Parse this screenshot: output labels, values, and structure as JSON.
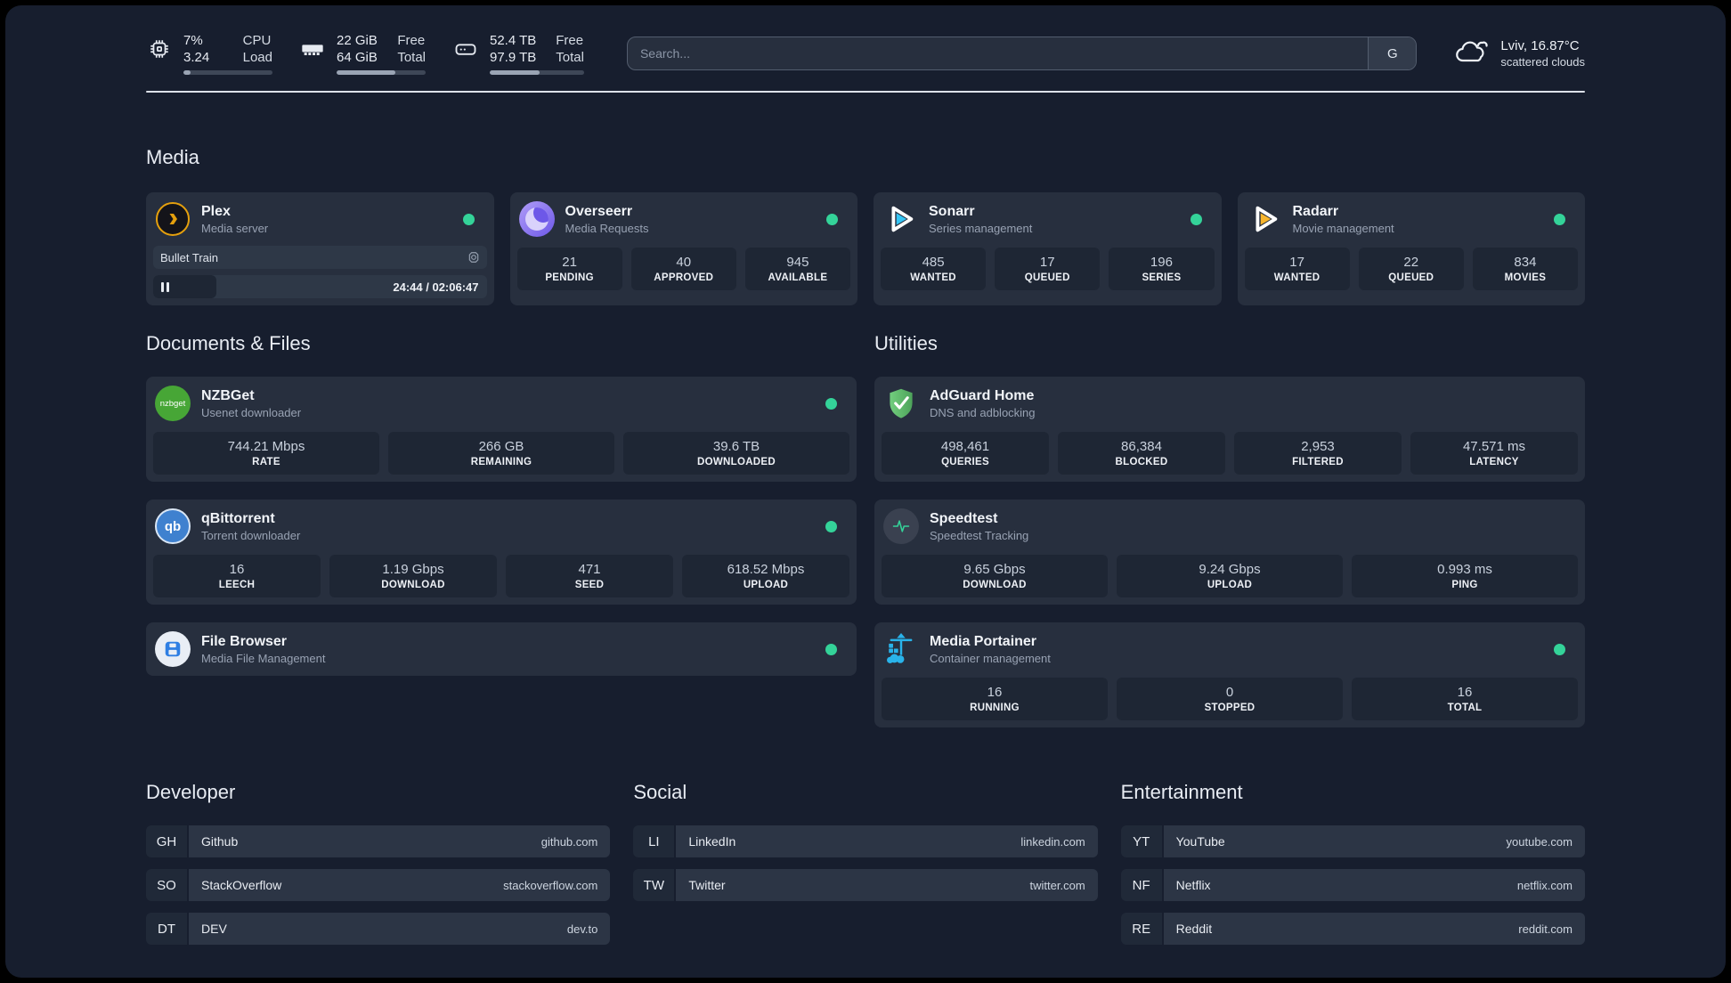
{
  "topbar": {
    "cpu": {
      "value1": "7%",
      "value2": "3.24",
      "label1": "CPU",
      "label2": "Load",
      "progress_pct": 8
    },
    "memory": {
      "value1": "22 GiB",
      "value2": "64 GiB",
      "label1": "Free",
      "label2": "Total",
      "progress_pct": 66
    },
    "disk": {
      "value1": "52.4 TB",
      "value2": "97.9 TB",
      "label1": "Free",
      "label2": "Total",
      "progress_pct": 53
    },
    "search": {
      "placeholder": "Search...",
      "provider_button": "G"
    },
    "weather": {
      "location_temp": "Lviv, 16.87°C",
      "condition": "scattered clouds",
      "icon": "cloud-icon"
    }
  },
  "sections": {
    "media": "Media",
    "documents": "Documents & Files",
    "utilities": "Utilities",
    "developer": "Developer",
    "social": "Social",
    "entertainment": "Entertainment"
  },
  "services": {
    "plex": {
      "name": "Plex",
      "desc": "Media server",
      "icon": "plex-icon",
      "status": "online",
      "now_playing": {
        "title": "Bullet Train",
        "time_display": "24:44 / 02:06:47",
        "progress_pct": 19,
        "state": "paused"
      }
    },
    "overseerr": {
      "name": "Overseerr",
      "desc": "Media Requests",
      "icon": "overseerr-icon",
      "status": "online",
      "stats": [
        {
          "value": "21",
          "label": "PENDING"
        },
        {
          "value": "40",
          "label": "APPROVED"
        },
        {
          "value": "945",
          "label": "AVAILABLE"
        }
      ]
    },
    "sonarr": {
      "name": "Sonarr",
      "desc": "Series management",
      "icon": "sonarr-icon",
      "status": "online",
      "stats": [
        {
          "value": "485",
          "label": "WANTED"
        },
        {
          "value": "17",
          "label": "QUEUED"
        },
        {
          "value": "196",
          "label": "SERIES"
        }
      ]
    },
    "radarr": {
      "name": "Radarr",
      "desc": "Movie management",
      "icon": "radarr-icon",
      "status": "online",
      "stats": [
        {
          "value": "17",
          "label": "WANTED"
        },
        {
          "value": "22",
          "label": "QUEUED"
        },
        {
          "value": "834",
          "label": "MOVIES"
        }
      ]
    },
    "nzbget": {
      "name": "NZBGet",
      "desc": "Usenet downloader",
      "icon": "nzbget-icon",
      "icon_text": "nzbget",
      "status": "online",
      "stats": [
        {
          "value": "744.21 Mbps",
          "label": "RATE"
        },
        {
          "value": "266 GB",
          "label": "REMAINING"
        },
        {
          "value": "39.6 TB",
          "label": "DOWNLOADED"
        }
      ]
    },
    "qbittorrent": {
      "name": "qBittorrent",
      "desc": "Torrent downloader",
      "icon": "qbittorrent-icon",
      "icon_text": "qb",
      "status": "online",
      "stats": [
        {
          "value": "16",
          "label": "LEECH"
        },
        {
          "value": "1.19 Gbps",
          "label": "DOWNLOAD"
        },
        {
          "value": "471",
          "label": "SEED"
        },
        {
          "value": "618.52 Mbps",
          "label": "UPLOAD"
        }
      ]
    },
    "filebrowser": {
      "name": "File Browser",
      "desc": "Media File Management",
      "icon": "filebrowser-icon",
      "status": "online",
      "stats": []
    },
    "adguard": {
      "name": "AdGuard Home",
      "desc": "DNS and adblocking",
      "icon": "adguard-icon",
      "status": "none",
      "stats": [
        {
          "value": "498,461",
          "label": "QUERIES"
        },
        {
          "value": "86,384",
          "label": "BLOCKED"
        },
        {
          "value": "2,953",
          "label": "FILTERED"
        },
        {
          "value": "47.571 ms",
          "label": "LATENCY"
        }
      ]
    },
    "speedtest": {
      "name": "Speedtest",
      "desc": "Speedtest Tracking",
      "icon": "speedtest-icon",
      "status": "none",
      "stats": [
        {
          "value": "9.65 Gbps",
          "label": "DOWNLOAD"
        },
        {
          "value": "9.24 Gbps",
          "label": "UPLOAD"
        },
        {
          "value": "0.993 ms",
          "label": "PING"
        }
      ]
    },
    "portainer": {
      "name": "Media Portainer",
      "desc": "Container management",
      "icon": "portainer-icon",
      "status": "online",
      "stats": [
        {
          "value": "16",
          "label": "RUNNING"
        },
        {
          "value": "0",
          "label": "STOPPED"
        },
        {
          "value": "16",
          "label": "TOTAL"
        }
      ]
    }
  },
  "bookmarks": {
    "developer": [
      {
        "abbr": "GH",
        "name": "Github",
        "url": "github.com"
      },
      {
        "abbr": "SO",
        "name": "StackOverflow",
        "url": "stackoverflow.com"
      },
      {
        "abbr": "DT",
        "name": "DEV",
        "url": "dev.to"
      }
    ],
    "social": [
      {
        "abbr": "LI",
        "name": "LinkedIn",
        "url": "linkedin.com"
      },
      {
        "abbr": "TW",
        "name": "Twitter",
        "url": "twitter.com"
      }
    ],
    "entertainment": [
      {
        "abbr": "YT",
        "name": "YouTube",
        "url": "youtube.com"
      },
      {
        "abbr": "NF",
        "name": "Netflix",
        "url": "netflix.com"
      },
      {
        "abbr": "RE",
        "name": "Reddit",
        "url": "reddit.com"
      }
    ]
  },
  "colors": {
    "status_online": "#34d399",
    "plex_accent": "#e5a00d",
    "sonarr_accent": "#35c5f4",
    "radarr_accent": "#f7b52c",
    "adguard_accent": "#5fbe6b",
    "portainer_accent": "#29b3ea"
  }
}
